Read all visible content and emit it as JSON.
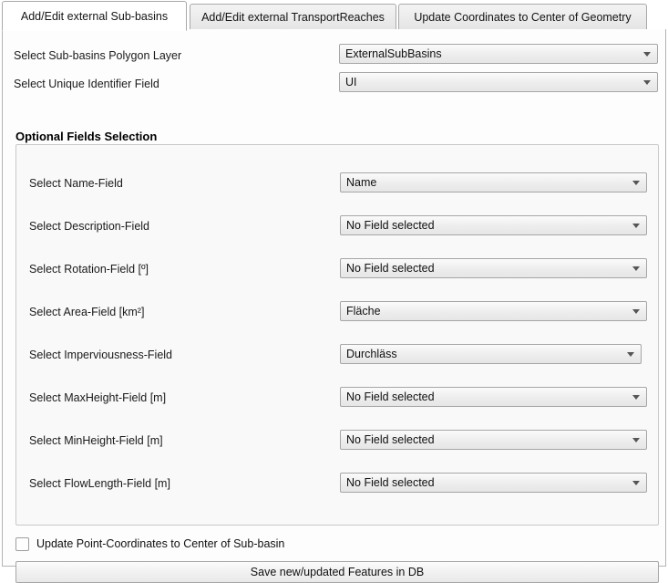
{
  "tabs": [
    {
      "label": "Add/Edit external Sub-basins",
      "active": true
    },
    {
      "label": "Add/Edit external TransportReaches",
      "active": false
    },
    {
      "label": "Update Coordinates to Center of Geometry",
      "active": false
    }
  ],
  "top_fields": [
    {
      "label": "Select Sub-basins Polygon Layer",
      "value": "ExternalSubBasins"
    },
    {
      "label": "Select Unique Identifier Field",
      "value": "UI"
    }
  ],
  "group": {
    "title": "Optional Fields Selection",
    "fields": [
      {
        "label": "Select Name-Field",
        "value": "Name"
      },
      {
        "label": "Select Description-Field",
        "value": "No Field selected"
      },
      {
        "label": "Select Rotation-Field [º]",
        "value": "No Field selected"
      },
      {
        "label": "Select Area-Field [km²]",
        "value": "Fläche"
      },
      {
        "label": "Select Imperviousness-Field",
        "value": "Durchläss"
      },
      {
        "label": "Select MaxHeight-Field [m]",
        "value": "No Field selected"
      },
      {
        "label": "Select MinHeight-Field [m]",
        "value": "No Field selected"
      },
      {
        "label": "Select FlowLength-Field [m]",
        "value": "No Field selected"
      }
    ]
  },
  "checkbox": {
    "label": "Update Point-Coordinates to Center of Sub-basin",
    "checked": false
  },
  "save_button": {
    "label": "Save new/updated Features in DB"
  },
  "colors": {
    "panel_background": "#fdfdfd",
    "group_background": "#f9f9f9",
    "border": "#b4b4b4",
    "combo_border": "#a6a6a6",
    "text": "#111111",
    "arrow": "#555555"
  }
}
